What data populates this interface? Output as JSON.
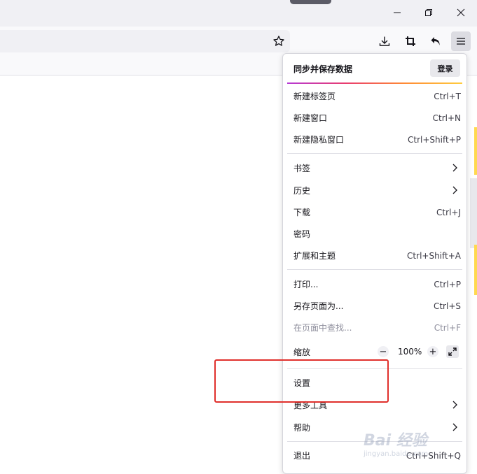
{
  "window": {
    "minimize_label": "minimize",
    "maximize_label": "restore",
    "close_label": "close"
  },
  "toolbar": {
    "icons": [
      "star-icon",
      "download-icon",
      "screenshot-icon",
      "undo-icon",
      "hamburger-menu-icon"
    ]
  },
  "menu": {
    "header_title": "同步并保存数据",
    "login_label": "登录",
    "items": [
      {
        "label": "新建标签页",
        "shortcut": "Ctrl+T"
      },
      {
        "label": "新建窗口",
        "shortcut": "Ctrl+N"
      },
      {
        "label": "新建隐私窗口",
        "shortcut": "Ctrl+Shift+P"
      },
      {
        "label": "书签",
        "submenu": true
      },
      {
        "label": "历史",
        "submenu": true
      },
      {
        "label": "下载",
        "shortcut": "Ctrl+J"
      },
      {
        "label": "密码"
      },
      {
        "label": "扩展和主题",
        "shortcut": "Ctrl+Shift+A"
      },
      {
        "label": "打印...",
        "shortcut": "Ctrl+P"
      },
      {
        "label": "另存页面为...",
        "shortcut": "Ctrl+S"
      },
      {
        "label": "在页面中查找...",
        "shortcut": "Ctrl+F",
        "disabled": true
      },
      {
        "label": "设置"
      },
      {
        "label": "更多工具",
        "submenu": true
      },
      {
        "label": "帮助",
        "submenu": true
      },
      {
        "label": "退出",
        "shortcut": "Ctrl+Shift+Q"
      }
    ],
    "zoom": {
      "label": "缩放",
      "minus": "−",
      "value": "100%",
      "plus": "+"
    }
  },
  "annotation": {
    "color": "#e0302c"
  },
  "watermark": {
    "main": "Bai 经验",
    "sub": "jingyan.baidu.com"
  },
  "colors": {
    "accent_gradient": [
      "#b63ad5",
      "#e93d6f",
      "#ff8a35",
      "#ffcc3e"
    ],
    "scroll_accent": "#ffd94f"
  }
}
